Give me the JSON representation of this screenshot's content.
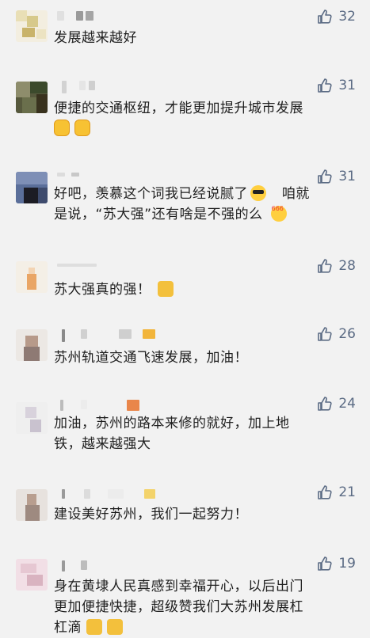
{
  "comments": [
    {
      "likes": "32",
      "lines": [
        "发展越来越好"
      ],
      "emoji": []
    },
    {
      "likes": "31",
      "lines": [
        "便捷的交通枢纽，才能更加提升城市发展"
      ],
      "emoji": [
        "fist-emoji",
        "fist-emoji"
      ]
    },
    {
      "likes": "31",
      "lines": [
        "好吧，羡慕这个词我已经说腻了",
        "咱就",
        "是说，“苏大强”还有啥是不强的么"
      ],
      "emoji": [
        "cool-emoji",
        "666-emoji"
      ]
    },
    {
      "likes": "28",
      "lines": [
        "苏大强真的强！"
      ],
      "emoji": [
        "thumbs-up-emoji"
      ]
    },
    {
      "likes": "26",
      "lines": [
        "苏州轨道交通飞速发展，加油！"
      ],
      "emoji": []
    },
    {
      "likes": "24",
      "lines": [
        "加油，苏州的路本来修的就好，加上地",
        "铁，越来越强大"
      ],
      "emoji": []
    },
    {
      "likes": "21",
      "lines": [
        "建设美好苏州，我们一起努力！"
      ],
      "emoji": []
    },
    {
      "likes": "19",
      "lines": [
        "身在黄埭人民真感到幸福开心，以后出门",
        "更加便捷快捷，超级赞我们大苏州发展杠",
        "杠滴"
      ],
      "emoji": [
        "thumbs-up-emoji",
        "thumbs-up-emoji"
      ]
    }
  ],
  "colors": {
    "like": "#5b6b84",
    "background": "#f2f2f2",
    "text": "#1f1f1f"
  },
  "icons": {
    "like": "thumbs-up-outline-icon"
  }
}
